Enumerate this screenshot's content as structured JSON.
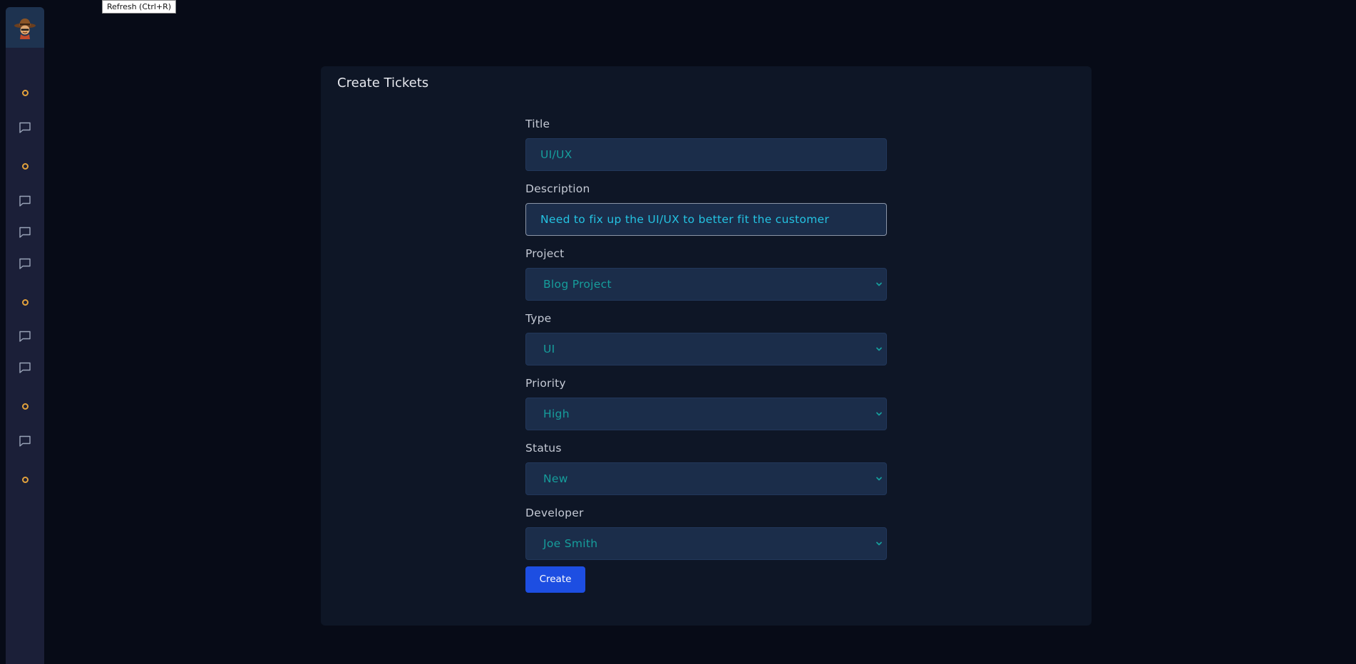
{
  "tooltip": {
    "text": "Refresh (Ctrl+R)"
  },
  "sidebar": {
    "logo": "cowboy-avatar-logo",
    "items": [
      {
        "icon": "circle-dot-icon"
      },
      {
        "icon": "chat-bubble-icon"
      },
      {
        "icon": "circle-dot-icon"
      },
      {
        "icon": "chat-bubble-icon"
      },
      {
        "icon": "chat-bubble-icon"
      },
      {
        "icon": "chat-bubble-icon"
      },
      {
        "icon": "circle-dot-icon"
      },
      {
        "icon": "chat-bubble-icon"
      },
      {
        "icon": "chat-bubble-icon"
      },
      {
        "icon": "circle-dot-icon"
      },
      {
        "icon": "chat-bubble-icon"
      },
      {
        "icon": "circle-dot-icon"
      }
    ]
  },
  "card": {
    "title": "Create Tickets"
  },
  "form": {
    "title": {
      "label": "Title",
      "value": "UI/UX"
    },
    "description": {
      "label": "Description",
      "value": "Need to fix up the UI/UX to better fit the customer"
    },
    "project": {
      "label": "Project",
      "value": "Blog Project"
    },
    "type": {
      "label": "Type",
      "value": "UI"
    },
    "priority": {
      "label": "Priority",
      "value": "High"
    },
    "status": {
      "label": "Status",
      "value": "New"
    },
    "developer": {
      "label": "Developer",
      "value": "Joe Smith"
    },
    "submit_label": "Create"
  },
  "colors": {
    "page_bg": "#070b17",
    "sidebar_bg": "#1b1f38",
    "card_bg": "#0e1626",
    "field_bg": "#1b2d4a",
    "field_text": "#169e9c",
    "accent_dot": "#e3a23c",
    "button_bg": "#1d4ee2"
  }
}
